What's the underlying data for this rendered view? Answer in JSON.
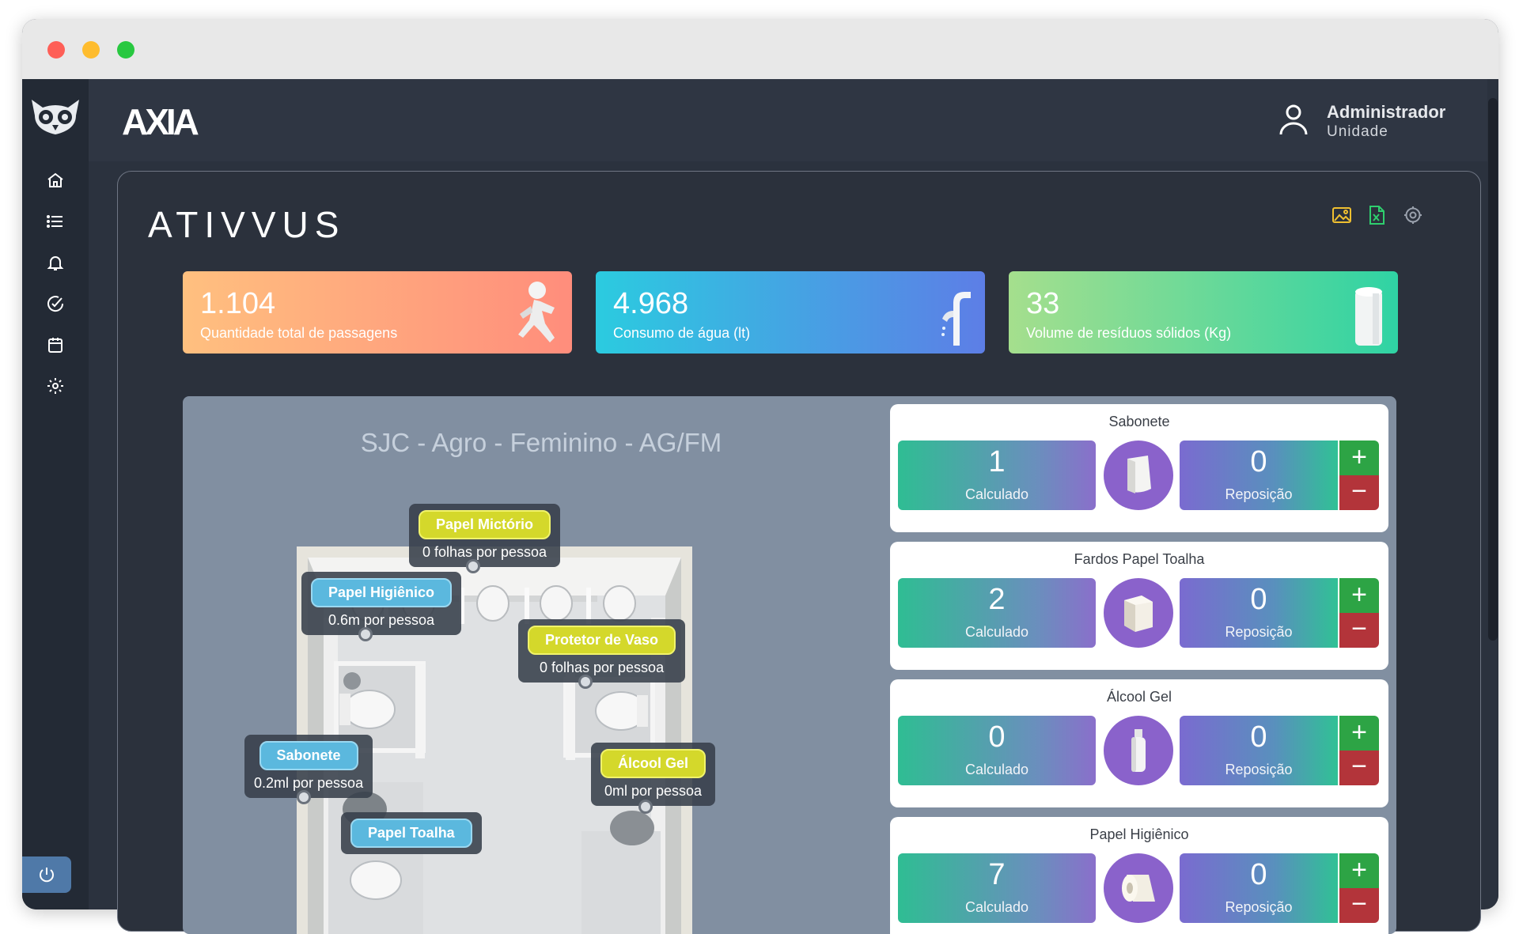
{
  "header": {
    "brand": "AXIA",
    "user_name": "Administrador",
    "user_role": "Unidade"
  },
  "sidebar": {
    "items": [
      {
        "icon": "home-icon"
      },
      {
        "icon": "list-icon"
      },
      {
        "icon": "bell-icon"
      },
      {
        "icon": "check-circle-icon"
      },
      {
        "icon": "calendar-icon"
      },
      {
        "icon": "gear-icon"
      }
    ],
    "power_icon": "power-icon"
  },
  "panel": {
    "title": "ATIVVUS",
    "tools": [
      "image-icon",
      "excel-icon",
      "gear-icon"
    ]
  },
  "kpis": [
    {
      "value": "1.104",
      "label": "Quantidade total de passagens",
      "colors": [
        "#ffc07f",
        "#ff8d7c"
      ]
    },
    {
      "value": "4.968",
      "label": "Consumo de água (lt)",
      "colors": [
        "#2bcbe0",
        "#5d7ee6"
      ]
    },
    {
      "value": "33",
      "label": "Volume de resíduos sólidos (Kg)",
      "colors": [
        "#a5df8d",
        "#2fd3a4"
      ]
    }
  ],
  "room": {
    "title": "SJC - Agro - Feminino - AG/FM",
    "tags": [
      {
        "name": "Papel Mictório",
        "detail": "0 folhas por pessoa",
        "style": "yellow"
      },
      {
        "name": "Papel Higiênico",
        "detail": "0.6m por pessoa",
        "style": "blue"
      },
      {
        "name": "Protetor de Vaso",
        "detail": "0 folhas por pessoa",
        "style": "yellow"
      },
      {
        "name": "Sabonete",
        "detail": "0.2ml por pessoa",
        "style": "blue"
      },
      {
        "name": "Álcool Gel",
        "detail": "0ml por pessoa",
        "style": "yellow"
      },
      {
        "name": "Papel Toalha",
        "detail": "",
        "style": "blue"
      }
    ]
  },
  "supplies": {
    "calc_label": "Calculado",
    "repo_label": "Reposição",
    "plus": "+",
    "minus": "−",
    "items": [
      {
        "title": "Sabonete",
        "calculated": "1",
        "replenish": "0",
        "icon": "soap-dispenser-icon"
      },
      {
        "title": "Fardos Papel Toalha",
        "calculated": "2",
        "replenish": "0",
        "icon": "towel-dispenser-icon"
      },
      {
        "title": "Álcool Gel",
        "calculated": "0",
        "replenish": "0",
        "icon": "gel-bottle-icon"
      },
      {
        "title": "Papel Higiênico",
        "calculated": "7",
        "replenish": "0",
        "icon": "toilet-paper-icon"
      }
    ]
  }
}
